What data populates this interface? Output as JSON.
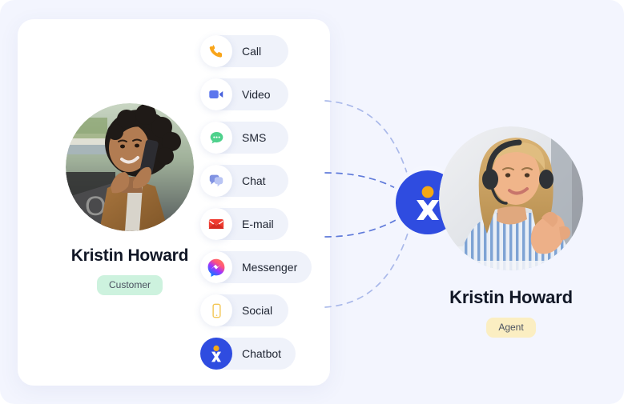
{
  "theme": {
    "page_background": "#f3f5fe",
    "card_background": "#ffffff",
    "pill_background": "#eff2fa",
    "brand_blue": "#2f4ce0",
    "brand_orange": "#f5a814",
    "connector_line": "#7d93e0",
    "customer_badge_bg": "#cdf2de",
    "agent_badge_bg": "#fbeec2",
    "text_primary": "#111726"
  },
  "customer": {
    "name": "Kristin Howard",
    "role_badge": "Customer",
    "avatar_alt": "woman with curly hair smiling while talking on a mobile phone outdoors"
  },
  "agent": {
    "name": "Kristin Howard",
    "role_badge": "Agent",
    "avatar_alt": "blonde woman wearing a headset in a blue striped shirt gesturing toward camera"
  },
  "hub": {
    "icon": "chatbot-logo-icon",
    "dot_color": "#f5a814",
    "circle_color": "#2f4ce0"
  },
  "channels": [
    {
      "label": "Call",
      "icon": "phone-icon",
      "color": "#f9a51a"
    },
    {
      "label": "Video",
      "icon": "video-icon",
      "color": "#5b76ed"
    },
    {
      "label": "SMS",
      "icon": "sms-icon",
      "color": "#4ed18c"
    },
    {
      "label": "Chat",
      "icon": "chat-icon",
      "color": "#8f9fe8"
    },
    {
      "label": "E-mail",
      "icon": "email-icon",
      "color": "#ef3b30"
    },
    {
      "label": "Messenger",
      "icon": "messenger-icon",
      "color": "#b02de0"
    },
    {
      "label": "Social",
      "icon": "social-icon",
      "color": "#f3c653"
    },
    {
      "label": "Chatbot",
      "icon": "chatbot-icon",
      "color": "#2f4ce0"
    }
  ],
  "connectors": {
    "count": 4,
    "style": "dashed",
    "description": "four dashed curved lines linking the channel card to the central hub badge"
  }
}
